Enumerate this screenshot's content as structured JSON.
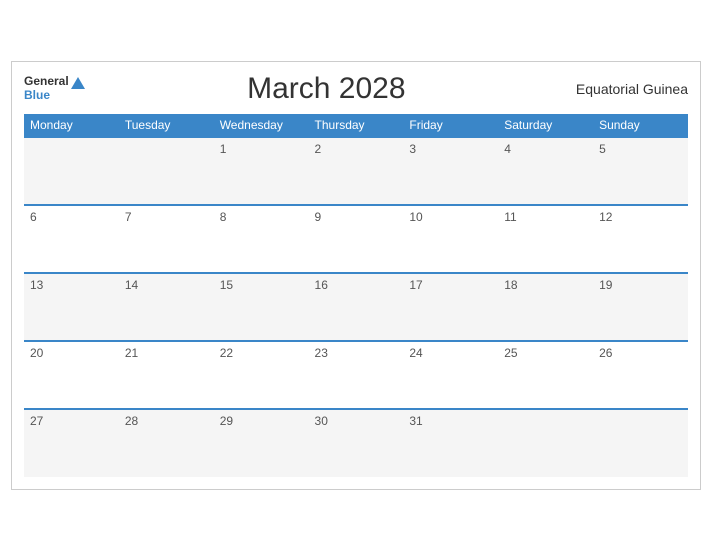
{
  "header": {
    "logo_general": "General",
    "logo_blue": "Blue",
    "title": "March 2028",
    "country": "Equatorial Guinea"
  },
  "days_of_week": [
    "Monday",
    "Tuesday",
    "Wednesday",
    "Thursday",
    "Friday",
    "Saturday",
    "Sunday"
  ],
  "weeks": [
    [
      "",
      "",
      "1",
      "2",
      "3",
      "4",
      "5"
    ],
    [
      "6",
      "7",
      "8",
      "9",
      "10",
      "11",
      "12"
    ],
    [
      "13",
      "14",
      "15",
      "16",
      "17",
      "18",
      "19"
    ],
    [
      "20",
      "21",
      "22",
      "23",
      "24",
      "25",
      "26"
    ],
    [
      "27",
      "28",
      "29",
      "30",
      "31",
      "",
      ""
    ]
  ]
}
